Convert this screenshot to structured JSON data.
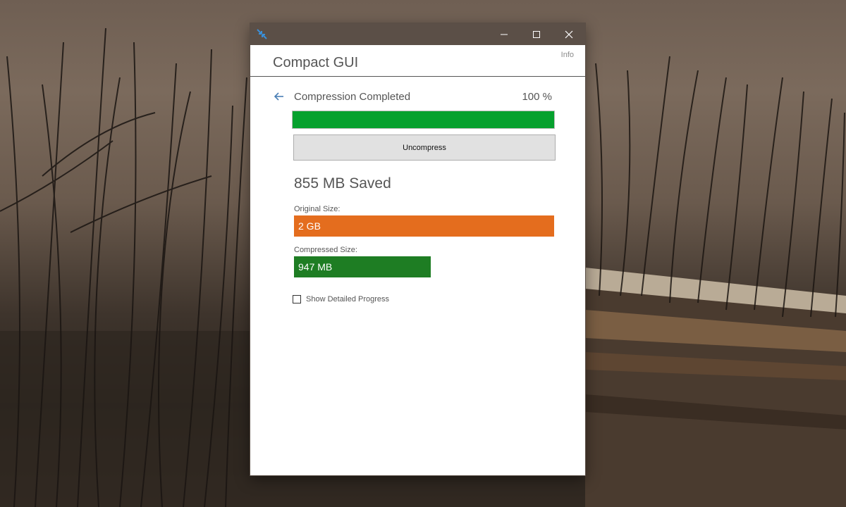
{
  "window": {
    "title_icon": "compact-arrows-icon",
    "controls": {
      "minimize": "minimize-icon",
      "maximize": "maximize-icon",
      "close": "close-icon"
    }
  },
  "header": {
    "app_title": "Compact GUI",
    "info_link": "Info"
  },
  "status": {
    "back_icon": "back-arrow-icon",
    "text": "Compression Completed",
    "percent": "100 %",
    "progress": 1.0,
    "progress_color": "#06a12e"
  },
  "actions": {
    "uncompress_label": "Uncompress"
  },
  "results": {
    "saved_text": "855 MB Saved",
    "original_label": "Original Size:",
    "original_value": "2 GB",
    "original_color": "#e46d1e",
    "compressed_label": "Compressed Size:",
    "compressed_value": "947 MB",
    "compressed_color": "#1e7d23"
  },
  "options": {
    "show_detailed_progress_label": "Show Detailed Progress",
    "show_detailed_progress_checked": false
  }
}
